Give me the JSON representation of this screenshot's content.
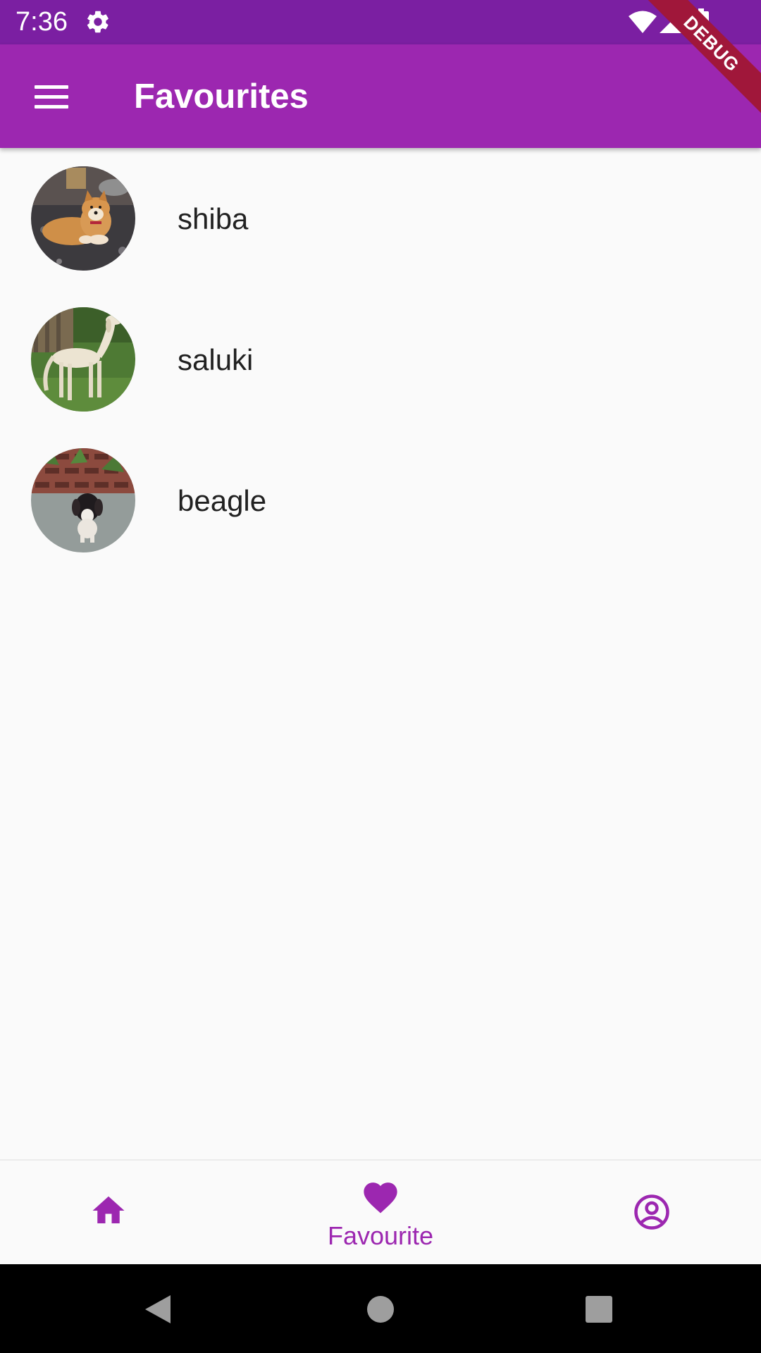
{
  "status_bar": {
    "time": "7:36",
    "icons": [
      "settings-icon",
      "wifi-icon",
      "signal-icon",
      "battery-icon"
    ]
  },
  "app_bar": {
    "title": "Favourites",
    "menu_icon": "menu-icon",
    "debug_banner": "DEBUG"
  },
  "favourites": [
    {
      "label": "shiba"
    },
    {
      "label": "saluki"
    },
    {
      "label": "beagle"
    }
  ],
  "bottom_nav": {
    "items": [
      {
        "icon": "home-icon",
        "label": "",
        "active": false
      },
      {
        "icon": "heart-icon",
        "label": "Favourite",
        "active": true
      },
      {
        "icon": "account-circle-icon",
        "label": "",
        "active": false
      }
    ]
  },
  "system_nav": {
    "icons": [
      "back-icon",
      "home-circle-icon",
      "recents-icon"
    ]
  },
  "colors": {
    "primary": "#9c27b0",
    "primary_dark": "#7b1fa2",
    "background": "#fafafa",
    "text": "#212121",
    "debug_ribbon": "#a0173a"
  }
}
